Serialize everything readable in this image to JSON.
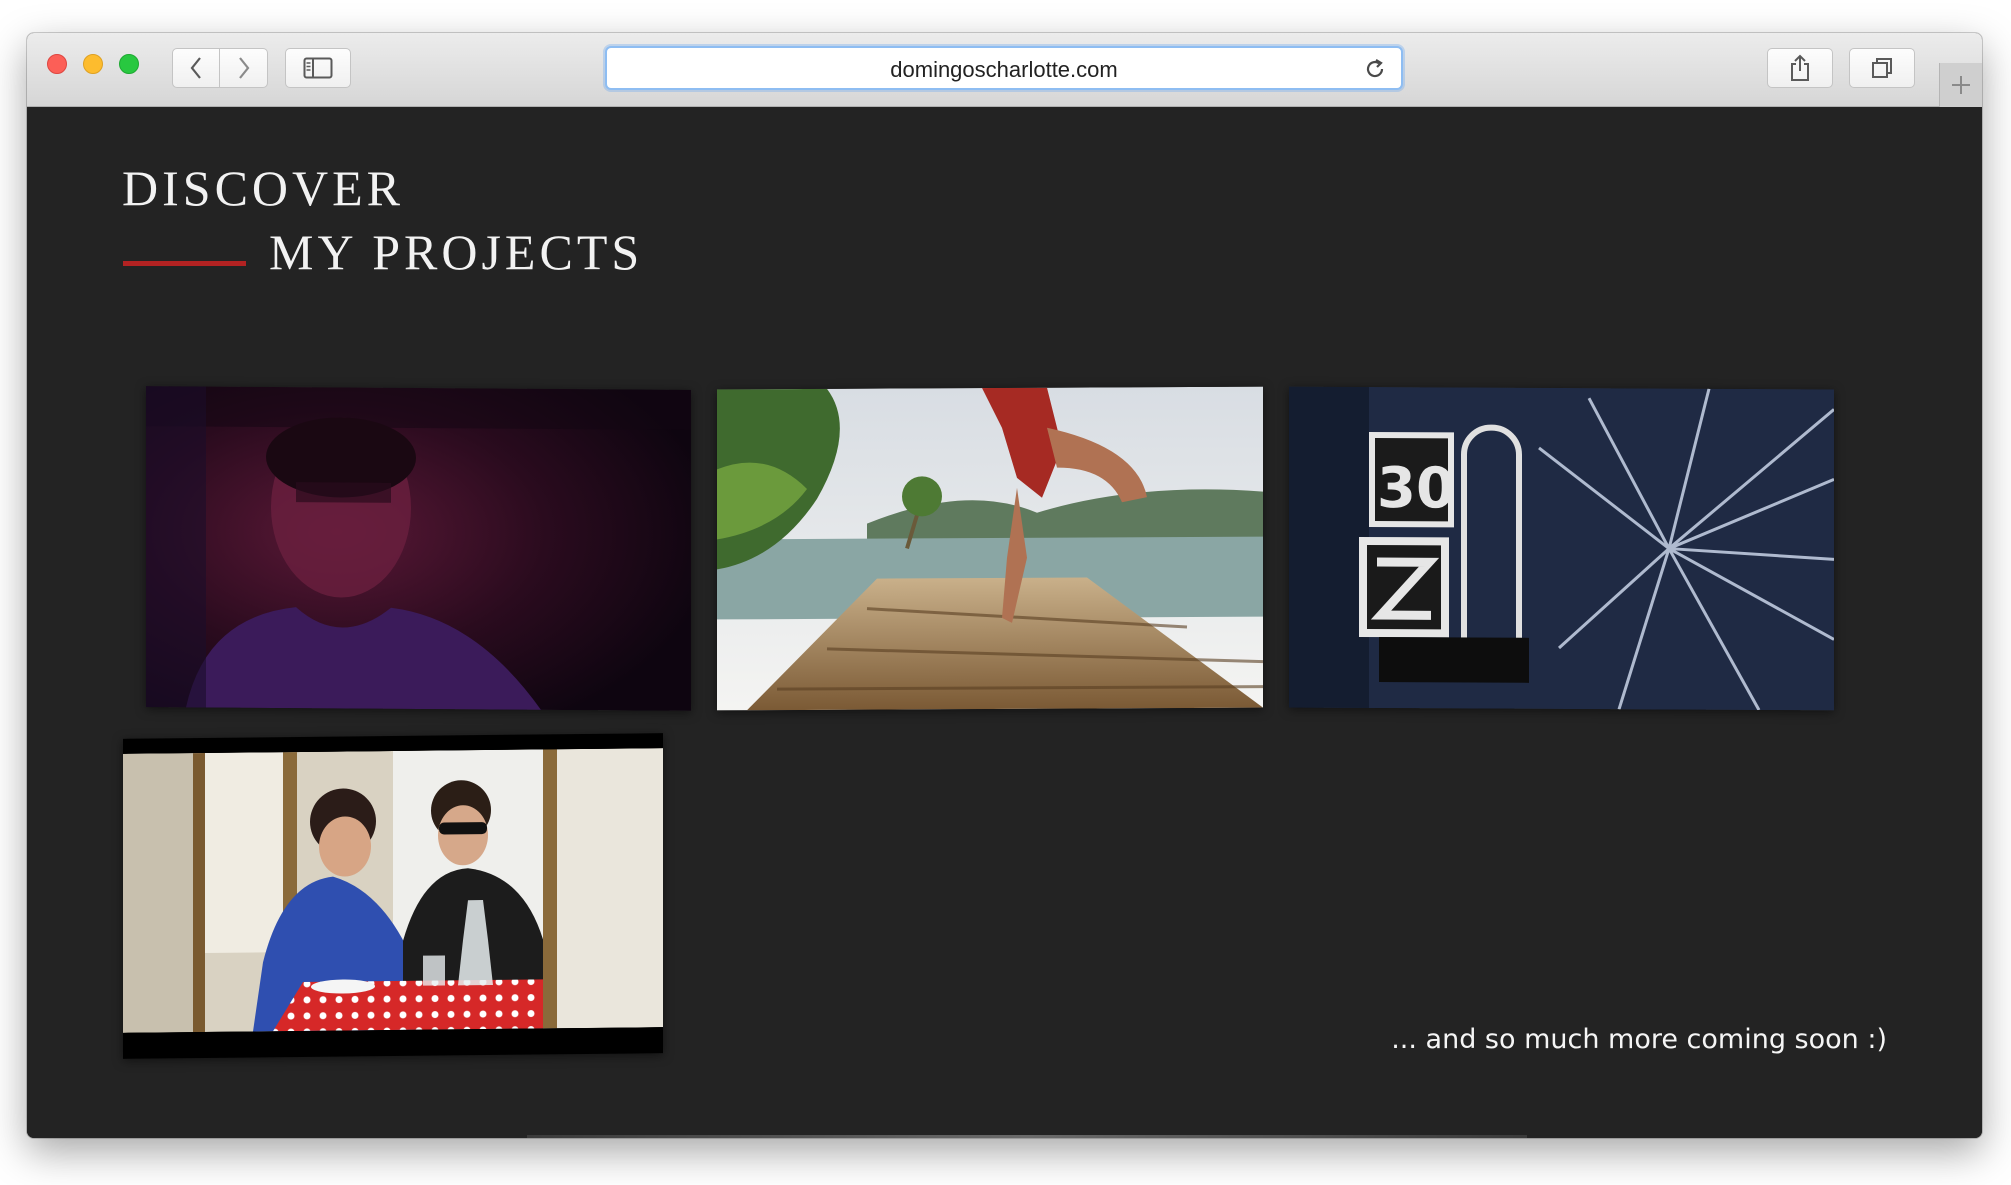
{
  "browser": {
    "url": "domingoscharlotte.com",
    "icons": {
      "back": "chevron-left-icon",
      "forward": "chevron-right-icon",
      "sidebar": "sidebar-icon",
      "reload": "reload-icon",
      "share": "share-icon",
      "tabs": "tabs-overview-icon",
      "new_tab": "plus-icon"
    }
  },
  "page": {
    "heading_line_1": "DISCOVER",
    "heading_line_2": "MY PROJECTS",
    "accent_color": "#b22222",
    "background_color": "#232323",
    "projects": [
      {
        "image": "man-in-purple-light"
      },
      {
        "image": "running-on-wooden-dock"
      },
      {
        "image": "street-sign-30-monochrome"
      },
      {
        "image": "couple-at-cafe-table"
      }
    ],
    "footer_note": "... and so much more coming soon :)"
  }
}
